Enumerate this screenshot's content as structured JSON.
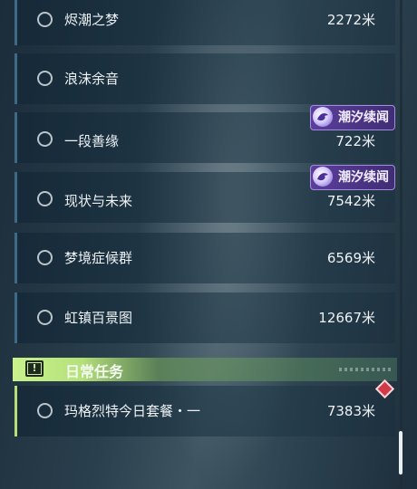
{
  "quests": [
    {
      "name": "烬潮之梦",
      "distance": "2272米",
      "badge": ""
    },
    {
      "name": "浪沫余音",
      "distance": "",
      "badge": ""
    },
    {
      "name": "一段善缘",
      "distance": "722米",
      "badge": "潮汐续闻"
    },
    {
      "name": "现状与未来",
      "distance": "7542米",
      "badge": "潮汐续闻"
    },
    {
      "name": "梦境症候群",
      "distance": "6569米",
      "badge": ""
    },
    {
      "name": "虹镇百景图",
      "distance": "12667米",
      "badge": ""
    }
  ],
  "daily_section": {
    "title": "日常任务",
    "quests": [
      {
        "name": "玛格烈特今日套餐・一",
        "distance": "7383米"
      }
    ]
  },
  "colors": {
    "badge_purple": "#5b3f9b",
    "daily_green": "#c9f28d",
    "tracked_red": "#d23a4a"
  },
  "icons": [
    "circle-bullet-icon",
    "tidal-badge-icon",
    "alert-icon",
    "tracked-diamond-icon"
  ]
}
